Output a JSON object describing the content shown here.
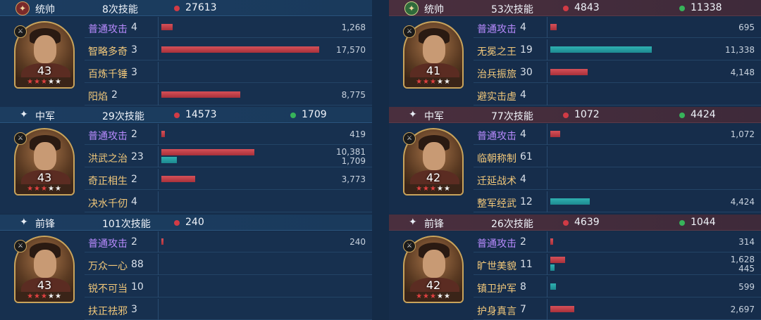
{
  "left": {
    "sections": [
      {
        "role": "统帅",
        "skills_count": "8次技能",
        "damage": "27613",
        "heal": "",
        "level": "43",
        "rows": [
          {
            "name": "普通攻击",
            "times": "4",
            "dmg": "1,268",
            "heal": "",
            "dmg_ratio": 0.072,
            "heal_ratio": 0
          },
          {
            "name": "智略多奇",
            "times": "3",
            "dmg": "17,570",
            "heal": "",
            "dmg_ratio": 1.0,
            "heal_ratio": 0
          },
          {
            "name": "百炼千锤",
            "times": "3",
            "dmg": "",
            "heal": "",
            "dmg_ratio": 0,
            "heal_ratio": 0
          },
          {
            "name": "阳焰",
            "times": "2",
            "dmg": "8,775",
            "heal": "",
            "dmg_ratio": 0.5,
            "heal_ratio": 0
          }
        ]
      },
      {
        "role": "中军",
        "skills_count": "29次技能",
        "damage": "14573",
        "heal": "1709",
        "level": "43",
        "rows": [
          {
            "name": "普通攻击",
            "times": "2",
            "dmg": "419",
            "heal": "",
            "dmg_ratio": 0.024,
            "heal_ratio": 0
          },
          {
            "name": "洪武之治",
            "times": "23",
            "dmg": "10,381",
            "heal": "1,709",
            "dmg_ratio": 0.59,
            "heal_ratio": 0.097
          },
          {
            "name": "奇正相生",
            "times": "2",
            "dmg": "3,773",
            "heal": "",
            "dmg_ratio": 0.215,
            "heal_ratio": 0
          },
          {
            "name": "决水千仞",
            "times": "4",
            "dmg": "",
            "heal": "",
            "dmg_ratio": 0,
            "heal_ratio": 0
          }
        ]
      },
      {
        "role": "前锋",
        "skills_count": "101次技能",
        "damage": "240",
        "heal": "",
        "level": "43",
        "rows": [
          {
            "name": "普通攻击",
            "times": "2",
            "dmg": "240",
            "heal": "",
            "dmg_ratio": 0.014,
            "heal_ratio": 0
          },
          {
            "name": "万众一心",
            "times": "88",
            "dmg": "",
            "heal": "",
            "dmg_ratio": 0,
            "heal_ratio": 0
          },
          {
            "name": "锐不可当",
            "times": "10",
            "dmg": "",
            "heal": "",
            "dmg_ratio": 0,
            "heal_ratio": 0
          },
          {
            "name": "扶正祛邪",
            "times": "3",
            "dmg": "",
            "heal": "",
            "dmg_ratio": 0,
            "heal_ratio": 0
          }
        ]
      }
    ]
  },
  "right": {
    "sections": [
      {
        "role": "统帅",
        "skills_count": "53次技能",
        "damage": "4843",
        "heal": "11338",
        "level": "41",
        "rows": [
          {
            "name": "普通攻击",
            "times": "4",
            "dmg": "695",
            "heal": "",
            "dmg_ratio": 0.04,
            "heal_ratio": 0
          },
          {
            "name": "无冕之王",
            "times": "19",
            "dmg": "",
            "heal": "11,338",
            "dmg_ratio": 0,
            "heal_ratio": 0.645
          },
          {
            "name": "治兵振旅",
            "times": "30",
            "dmg": "4,148",
            "heal": "",
            "dmg_ratio": 0.236,
            "heal_ratio": 0
          },
          {
            "name": "避实击虚",
            "times": "4",
            "dmg": "",
            "heal": "",
            "dmg_ratio": 0,
            "heal_ratio": 0
          }
        ]
      },
      {
        "role": "中军",
        "skills_count": "77次技能",
        "damage": "1072",
        "heal": "4424",
        "level": "42",
        "rows": [
          {
            "name": "普通攻击",
            "times": "4",
            "dmg": "1,072",
            "heal": "",
            "dmg_ratio": 0.061,
            "heal_ratio": 0
          },
          {
            "name": "临朝称制",
            "times": "61",
            "dmg": "",
            "heal": "",
            "dmg_ratio": 0,
            "heal_ratio": 0
          },
          {
            "name": "迁延战术",
            "times": "4",
            "dmg": "",
            "heal": "",
            "dmg_ratio": 0,
            "heal_ratio": 0
          },
          {
            "name": "整军经武",
            "times": "12",
            "dmg": "",
            "heal": "4,424",
            "dmg_ratio": 0,
            "heal_ratio": 0.252
          }
        ]
      },
      {
        "role": "前锋",
        "skills_count": "26次技能",
        "damage": "4639",
        "heal": "1044",
        "level": "42",
        "rows": [
          {
            "name": "普通攻击",
            "times": "2",
            "dmg": "314",
            "heal": "",
            "dmg_ratio": 0.018,
            "heal_ratio": 0
          },
          {
            "name": "旷世美貌",
            "times": "11",
            "dmg": "1,628",
            "heal": "445",
            "dmg_ratio": 0.093,
            "heal_ratio": 0.025
          },
          {
            "name": "镇卫护军",
            "times": "8",
            "dmg": "",
            "heal": "599",
            "dmg_ratio": 0,
            "heal_ratio": 0.034
          },
          {
            "name": "护身真言",
            "times": "7",
            "dmg": "2,697",
            "heal": "",
            "dmg_ratio": 0.153,
            "heal_ratio": 0
          }
        ]
      }
    ]
  },
  "colors": {
    "damage": "#d23b45",
    "heal": "#37b35a",
    "basic_skill": "#b98bff",
    "skill": "#f2c87a"
  },
  "icons": {
    "commander": "commander-badge-icon",
    "other": "star-icon",
    "damage": "red-dot-icon",
    "heal": "green-dot-icon"
  }
}
